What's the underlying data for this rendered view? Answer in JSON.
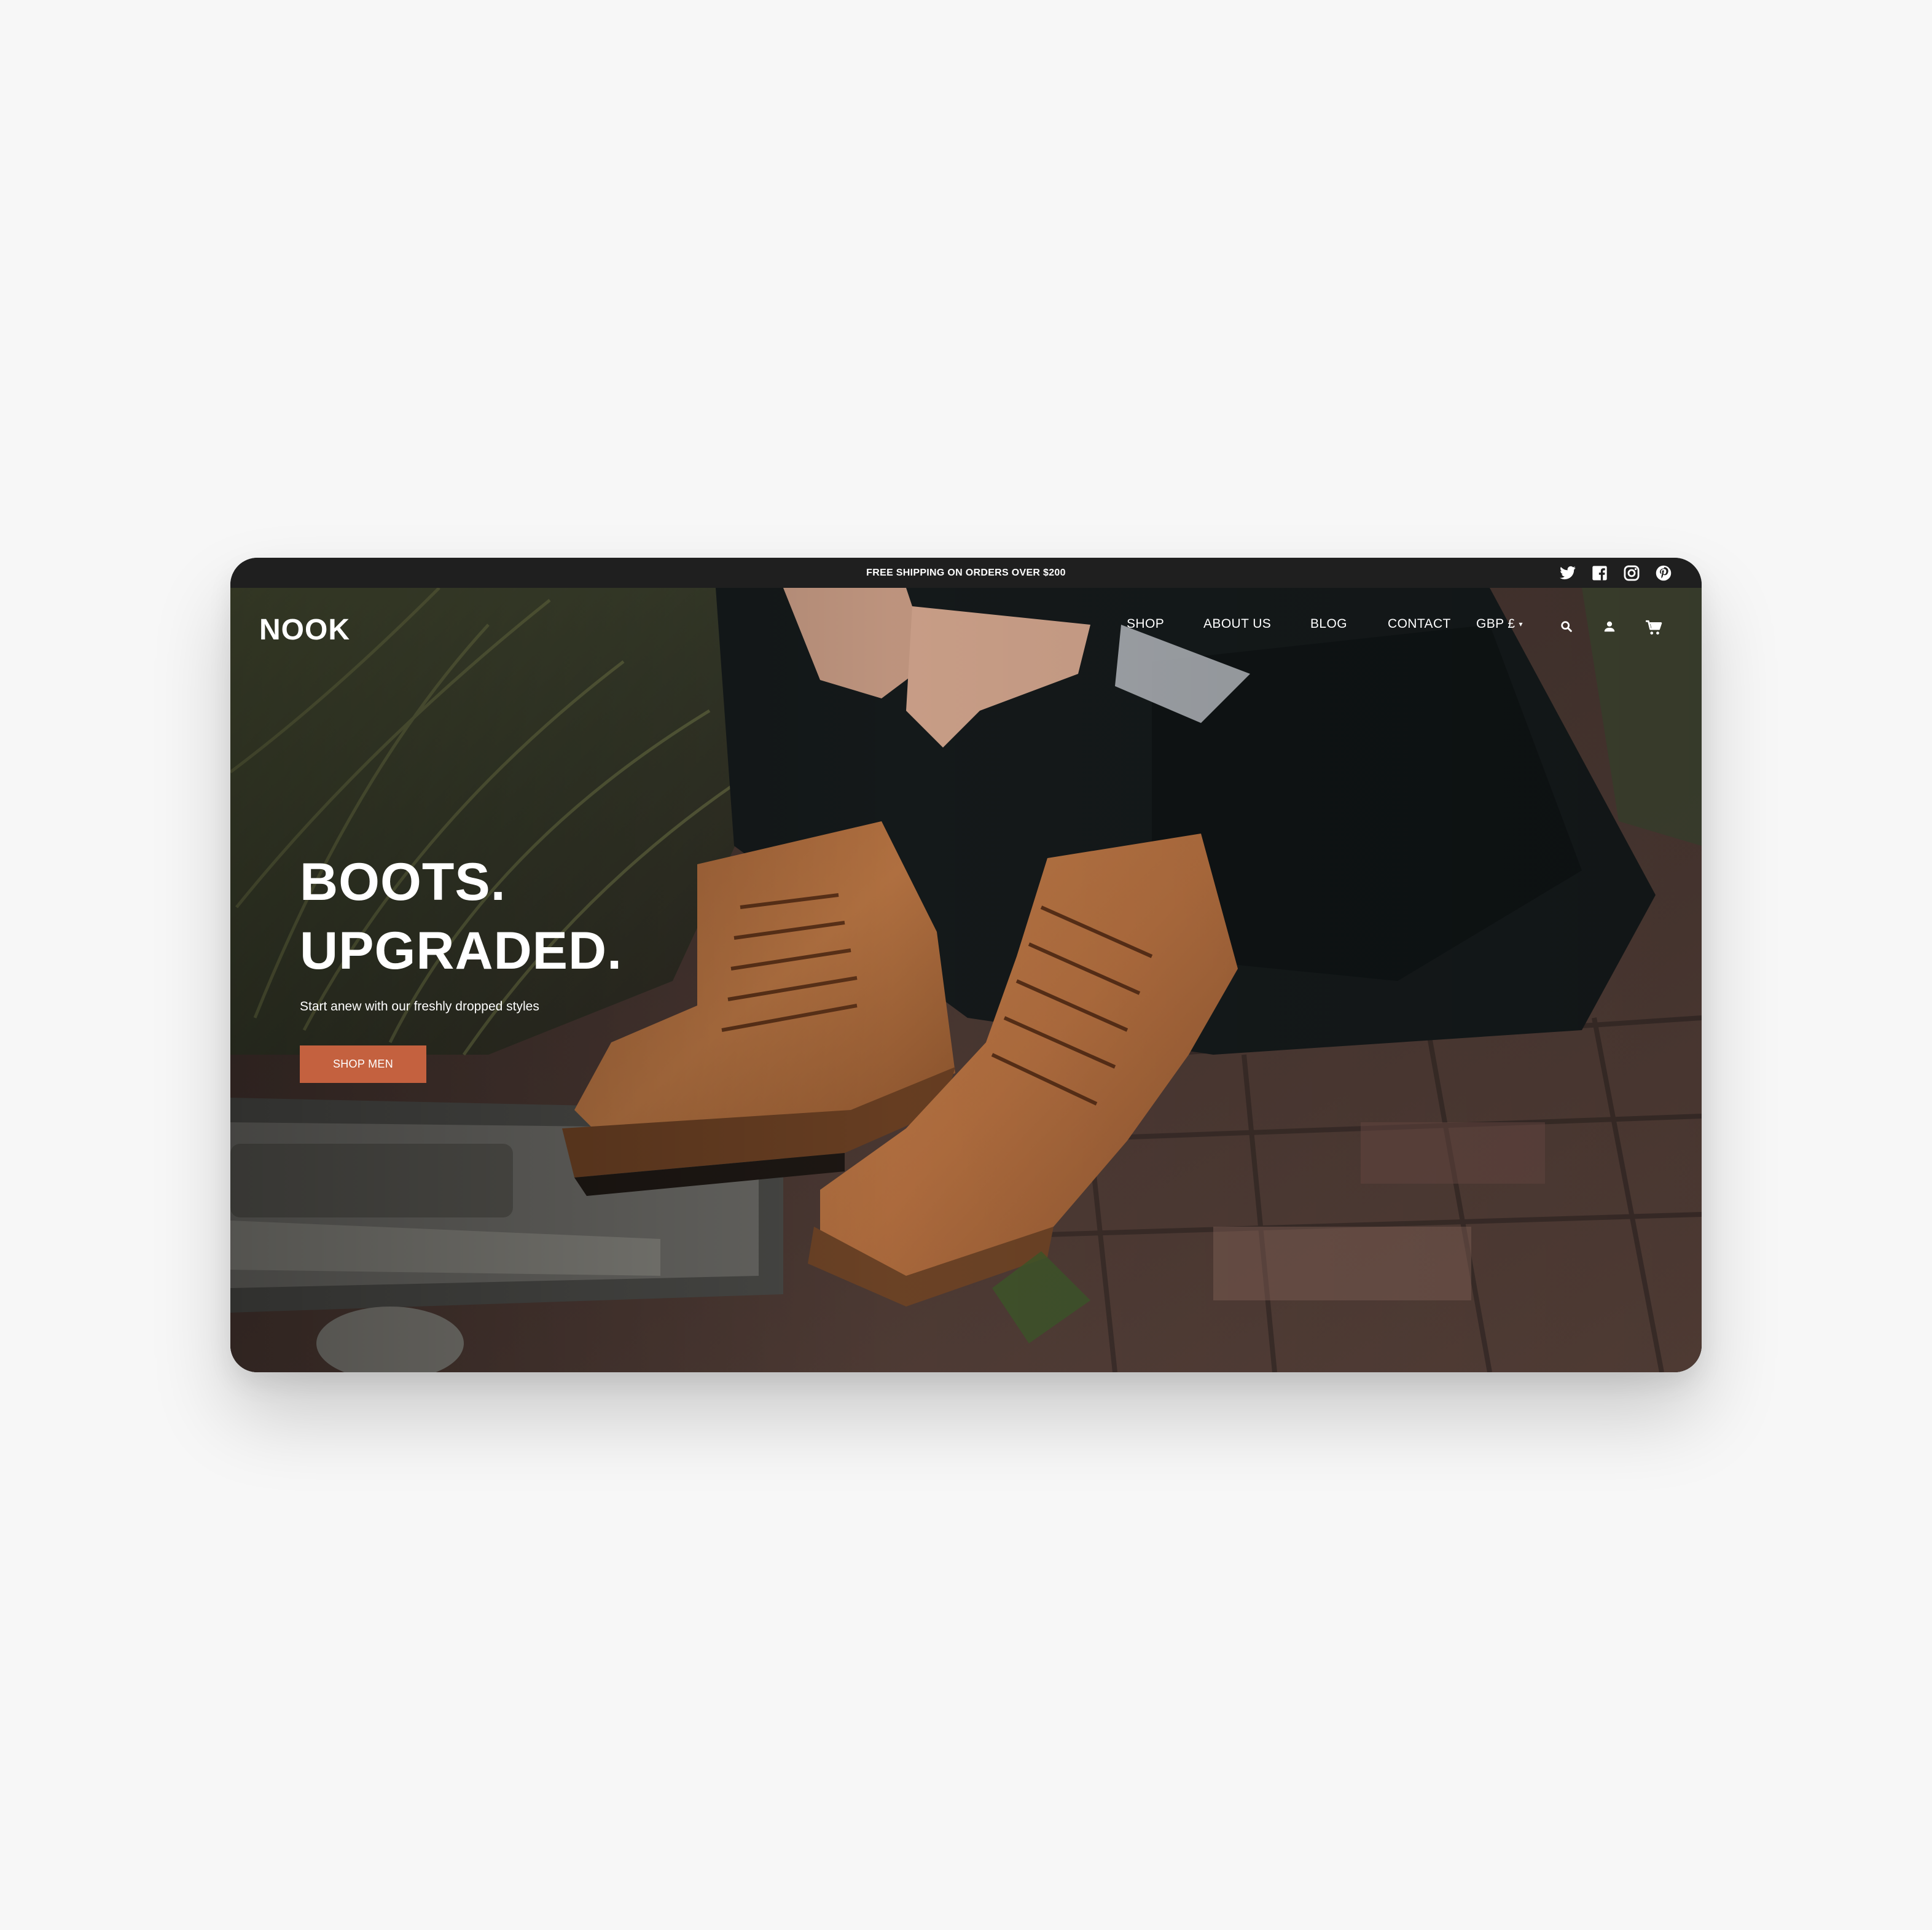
{
  "announcement": {
    "text": "FREE SHIPPING ON ORDERS OVER $200"
  },
  "social": {
    "icons": [
      "twitter-icon",
      "facebook-icon",
      "instagram-icon",
      "pinterest-icon"
    ]
  },
  "header": {
    "logo": "NOOK",
    "nav": {
      "shop": "SHOP",
      "about": "ABOUT US",
      "blog": "BLOG",
      "contact": "CONTACT",
      "currency": "GBP £"
    },
    "icons": [
      "search-icon",
      "account-icon",
      "cart-icon"
    ]
  },
  "hero": {
    "headline_line1": "BOOTS.",
    "headline_line2": "UPGRADED.",
    "subtext": "Start anew with our freshly dropped styles",
    "cta_label": "SHOP MEN"
  },
  "colors": {
    "announcement_bg": "#1f1f1f",
    "cta": "#c4613f",
    "text": "#ffffff",
    "page_bg": "#f7f7f7"
  }
}
